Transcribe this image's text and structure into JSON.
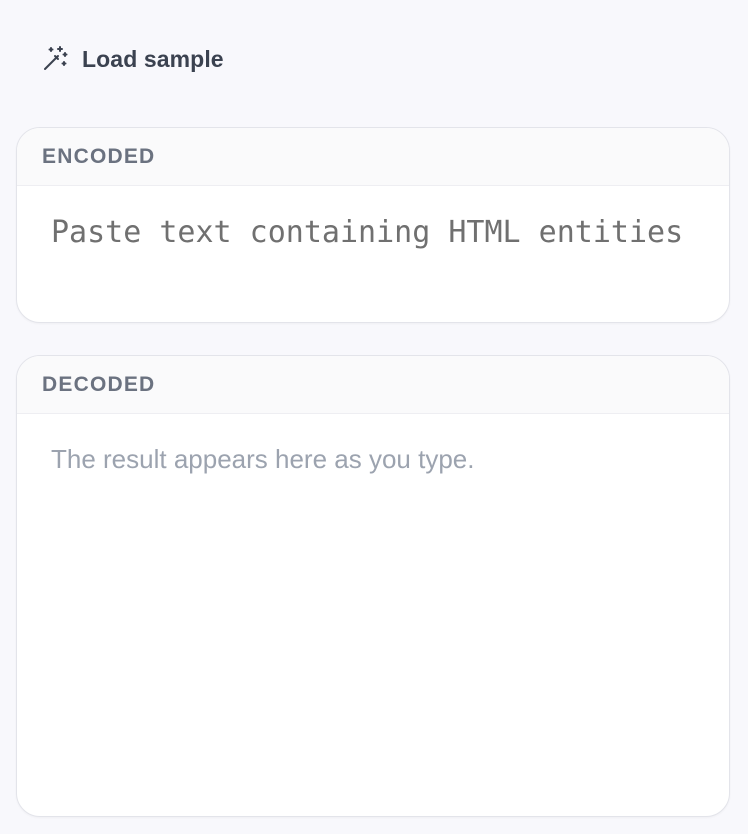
{
  "toolbar": {
    "load_sample_label": "Load sample",
    "load_sample_icon": "magic-wand-icon"
  },
  "encoded": {
    "header": "ENCODED",
    "value": "",
    "placeholder": "Paste text containing HTML entities"
  },
  "decoded": {
    "header": "DECODED",
    "placeholder": "The result appears here as you type."
  },
  "colors": {
    "background": "#f8f8fc",
    "panel_border": "#e3e4ea",
    "header_text": "#6b7280",
    "placeholder_text": "#9ca3af"
  }
}
